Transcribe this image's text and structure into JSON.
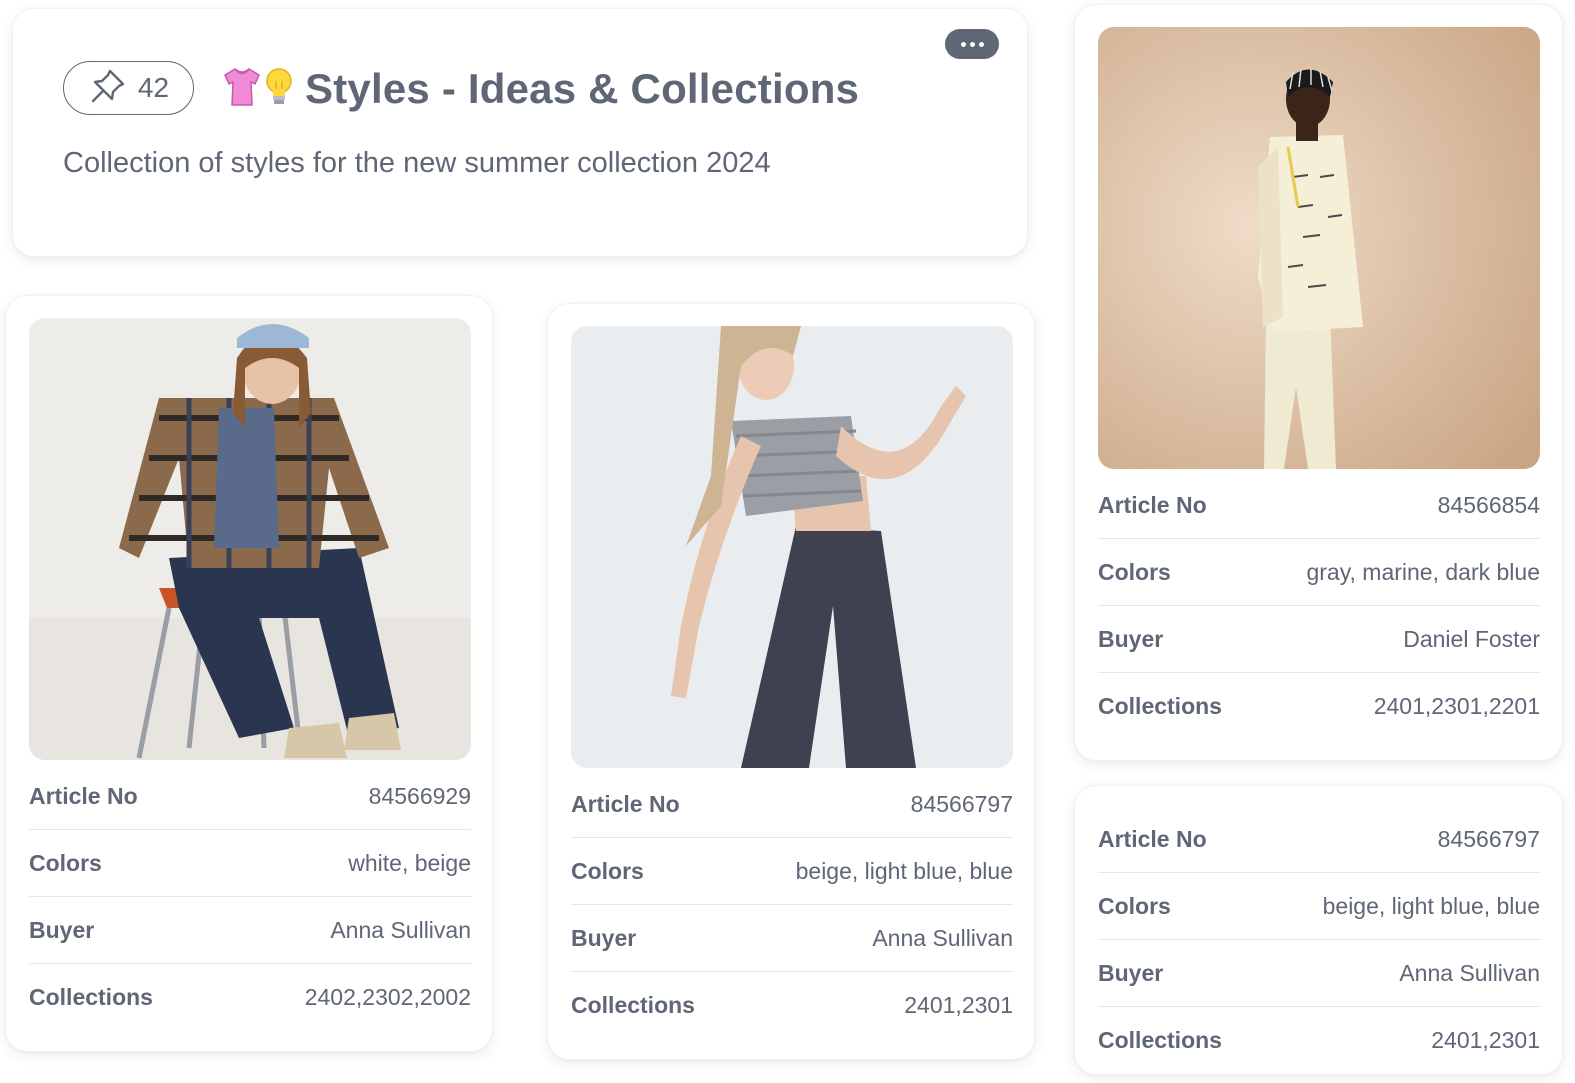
{
  "header": {
    "pin_count": "42",
    "title": "Styles - Ideas & Collections",
    "subtitle": "Collection of styles for the new summer collection 2024"
  },
  "icons": {
    "pin": "pin-icon",
    "more": "more-horizontal-icon",
    "shirt": "shirt-emoji-icon",
    "bulb": "lightbulb-emoji-icon"
  },
  "colors": {
    "text": "#5f6676",
    "divider": "#e4e6ea",
    "card_border": "#f1f2f4"
  },
  "products": [
    {
      "image": "Woman in plaid shirt, blue beanie and dark jeans sitting on a stool",
      "article_label": "Article No",
      "article_no": "84566929",
      "colors_label": "Colors",
      "colors": "white, beige",
      "buyer_label": "Buyer",
      "buyer": "Anna Sullivan",
      "collections_label": "Collections",
      "collections": "2402,2302,2002"
    },
    {
      "image": "Woman in gray knit crop top and dark wide trousers",
      "article_label": "Article No",
      "article_no": "84566797",
      "colors_label": "Colors",
      "colors": "beige, light blue, blue",
      "buyer_label": "Buyer",
      "buyer": "Anna Sullivan",
      "collections_label": "Collections",
      "collections": "2401,2301"
    },
    {
      "image": "Man in cream printed suit on beige backdrop",
      "article_label": "Article No",
      "article_no": "84566854",
      "colors_label": "Colors",
      "colors": "gray, marine, dark blue",
      "buyer_label": "Buyer",
      "buyer": "Daniel Foster",
      "collections_label": "Collections",
      "collections": "2401,2301,2201"
    },
    {
      "article_label": "Article No",
      "article_no": "84566797",
      "colors_label": "Colors",
      "colors": "beige, light blue, blue",
      "buyer_label": "Buyer",
      "buyer": "Anna Sullivan",
      "collections_label": "Collections",
      "collections": "2401,2301"
    }
  ]
}
